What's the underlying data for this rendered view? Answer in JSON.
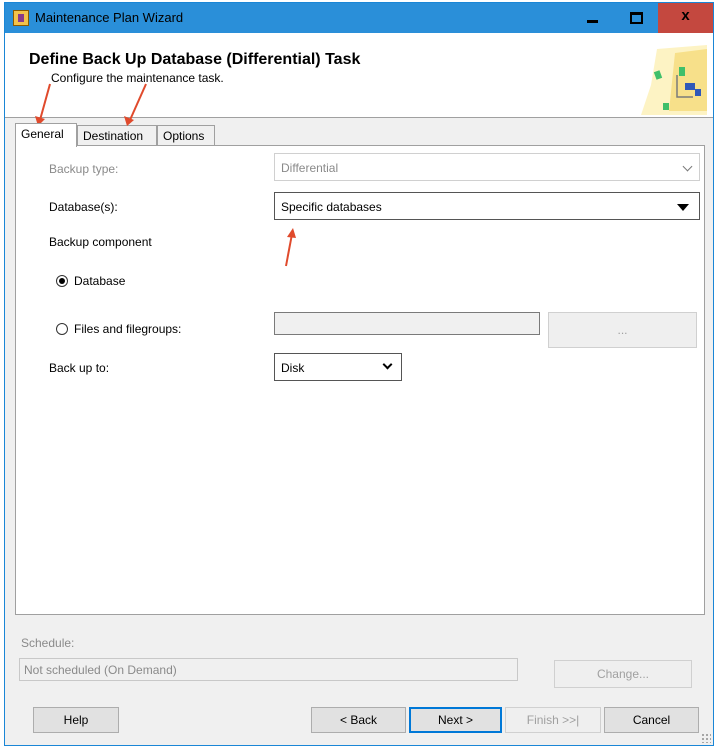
{
  "window": {
    "title": "Maintenance Plan Wizard",
    "close_glyph": "x"
  },
  "header": {
    "title": "Define Back Up Database (Differential) Task",
    "subtitle": "Configure the maintenance task."
  },
  "tabs": [
    {
      "label": "General",
      "active": true
    },
    {
      "label": "Destination",
      "active": false
    },
    {
      "label": "Options",
      "active": false
    }
  ],
  "general": {
    "backup_type_label": "Backup type:",
    "backup_type_value": "Differential",
    "databases_label": "Database(s):",
    "databases_value": "Specific databases",
    "backup_component_label": "Backup component",
    "radio_database_label": "Database",
    "radio_files_label": "Files and filegroups:",
    "files_browse_label": "...",
    "backup_to_label": "Back up to:",
    "backup_to_value": "Disk"
  },
  "schedule": {
    "label": "Schedule:",
    "value": "Not scheduled (On Demand)",
    "change_label": "Change..."
  },
  "footer": {
    "help": "Help",
    "back": "< Back",
    "next": "Next >",
    "finish": "Finish >>|",
    "cancel": "Cancel"
  },
  "colors": {
    "titlebar": "#2a8fd9",
    "close": "#c4483f",
    "annotation_arrow": "#e04a2c"
  }
}
